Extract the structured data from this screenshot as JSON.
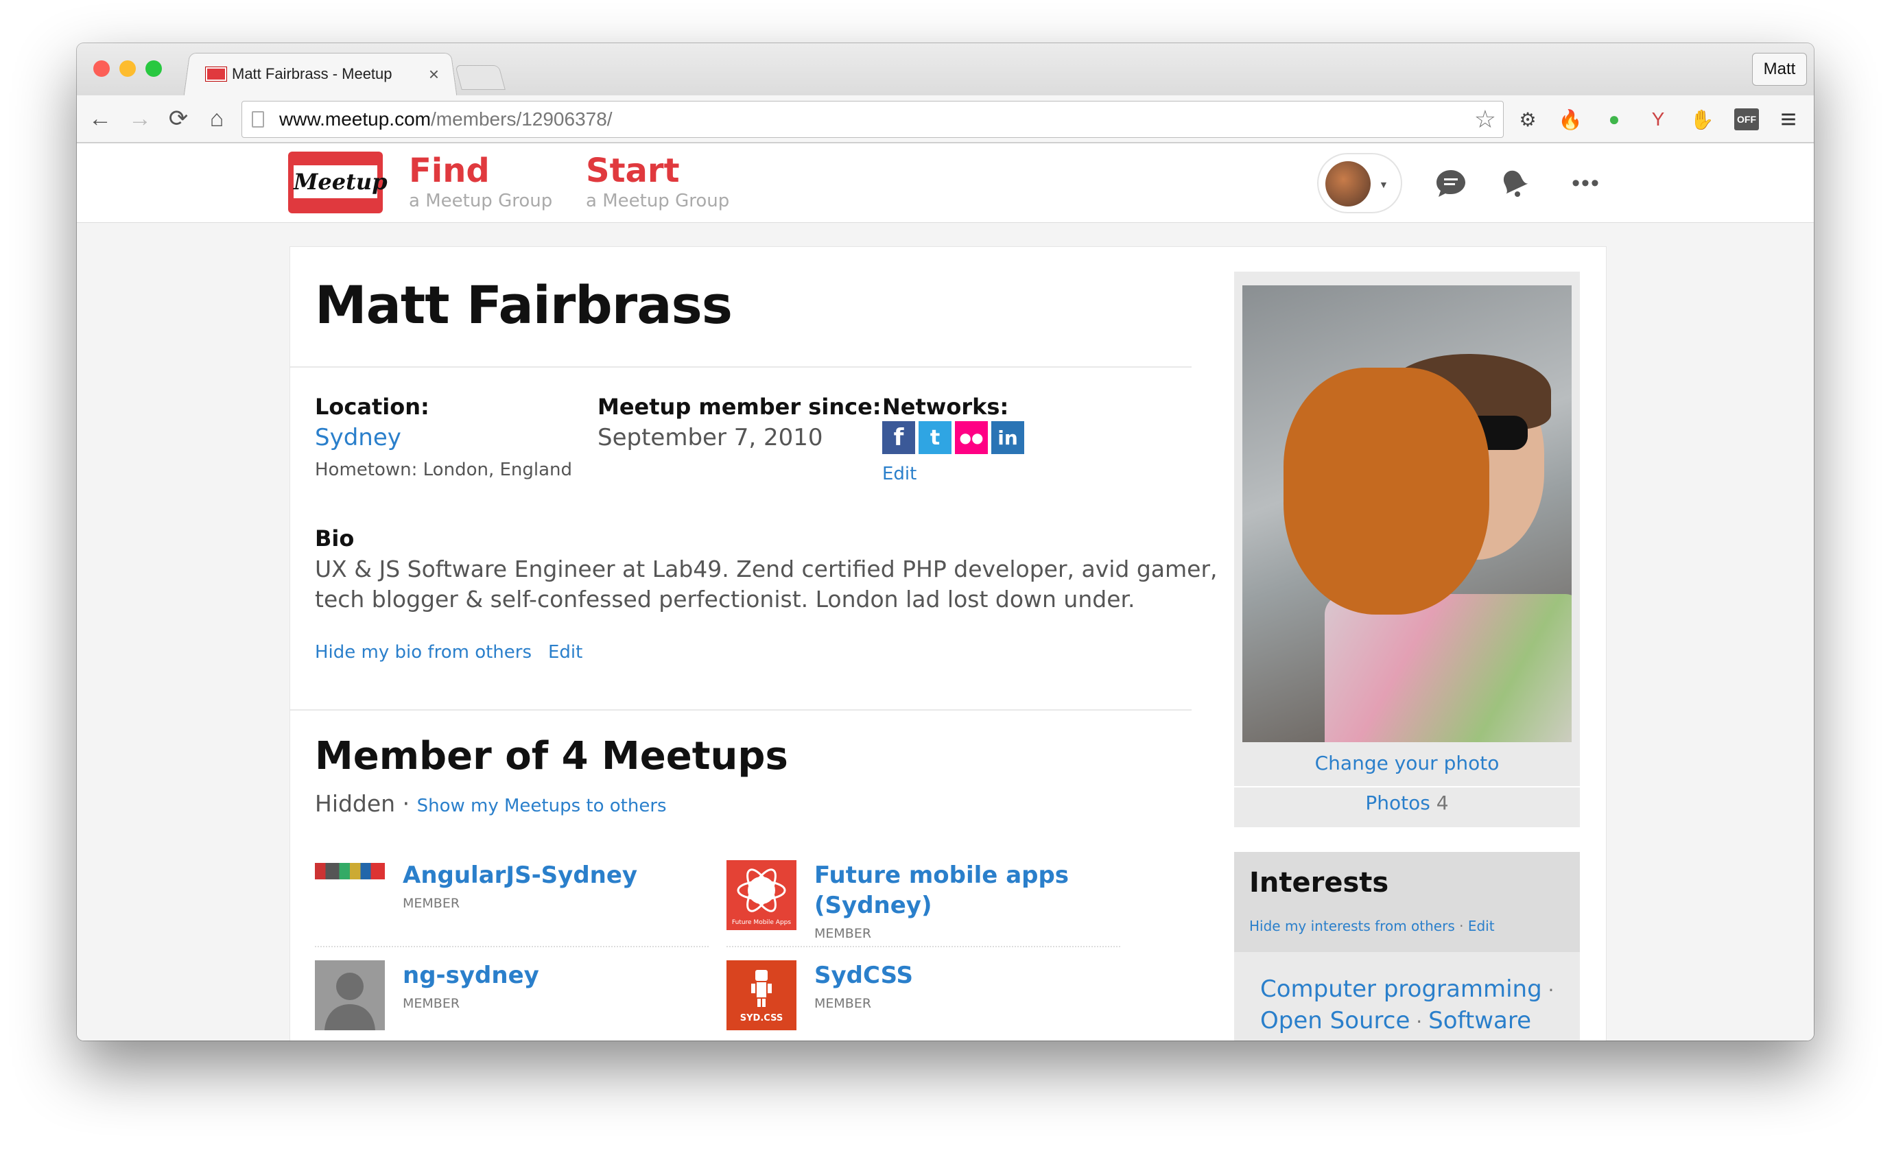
{
  "browser": {
    "tab_title": "Matt Fairbrass - Meetup",
    "tab_close": "×",
    "profile_label": "Matt",
    "url_host": "www.meetup.com",
    "url_path": "/members/12906378/",
    "nav_back": "←",
    "nav_forward": "→",
    "nav_reload": "⟳",
    "nav_home": "⌂",
    "star": "☆",
    "menu": "≡",
    "ext_off": "OFF"
  },
  "header": {
    "logo_text": "Meetup",
    "find_big": "Find",
    "find_small": "a Meetup Group",
    "start_big": "Start",
    "start_small": "a Meetup Group",
    "more": "•••"
  },
  "profile": {
    "name": "Matt Fairbrass",
    "location_label": "Location:",
    "location": "Sydney",
    "hometown": "Hometown: London, England",
    "member_since_label": "Meetup member since:",
    "member_since": "September 7, 2010",
    "networks_label": "Networks:",
    "networks_edit": "Edit",
    "networks": [
      {
        "icon": "facebook-icon",
        "glyph": "f",
        "color": "#3b5998"
      },
      {
        "icon": "twitter-icon",
        "glyph": "t",
        "color": "#2fa5e3"
      },
      {
        "icon": "flickr-icon",
        "glyph": "●●",
        "color": "#ff0084"
      },
      {
        "icon": "linkedin-icon",
        "glyph": "in",
        "color": "#2a74b5"
      }
    ],
    "bio_label": "Bio",
    "bio_line1": "UX & JS Software Engineer at Lab49. Zend certified PHP developer, avid gamer,",
    "bio_line2": "tech blogger & self-confessed perfectionist. London lad lost down under.",
    "bio_hide": "Hide my bio from others",
    "bio_edit": "Edit"
  },
  "meetups": {
    "title": "Member of 4 Meetups",
    "hidden": "Hidden",
    "sep": " · ",
    "show_link": "Show my Meetups to others",
    "groups": [
      {
        "name": "AngularJS-Sydney",
        "role": "MEMBER"
      },
      {
        "name1": "Future mobile apps",
        "name2": "(Sydney)",
        "role": "MEMBER",
        "thumb_text": "Future Mobile Apps"
      },
      {
        "name": "ng-sydney",
        "role": "MEMBER"
      },
      {
        "name": "SydCSS",
        "role": "MEMBER",
        "thumb_text": "SYD.CSS"
      }
    ]
  },
  "sidebar": {
    "change_photo": "Change your photo",
    "photos_label": "Photos",
    "photos_count": "4",
    "interests_title": "Interests",
    "hide_interests": "Hide my interests from others",
    "interests_edit": "Edit",
    "interest_sep": " · ",
    "interests": [
      "Computer programming",
      "Open Source",
      "Software"
    ]
  }
}
